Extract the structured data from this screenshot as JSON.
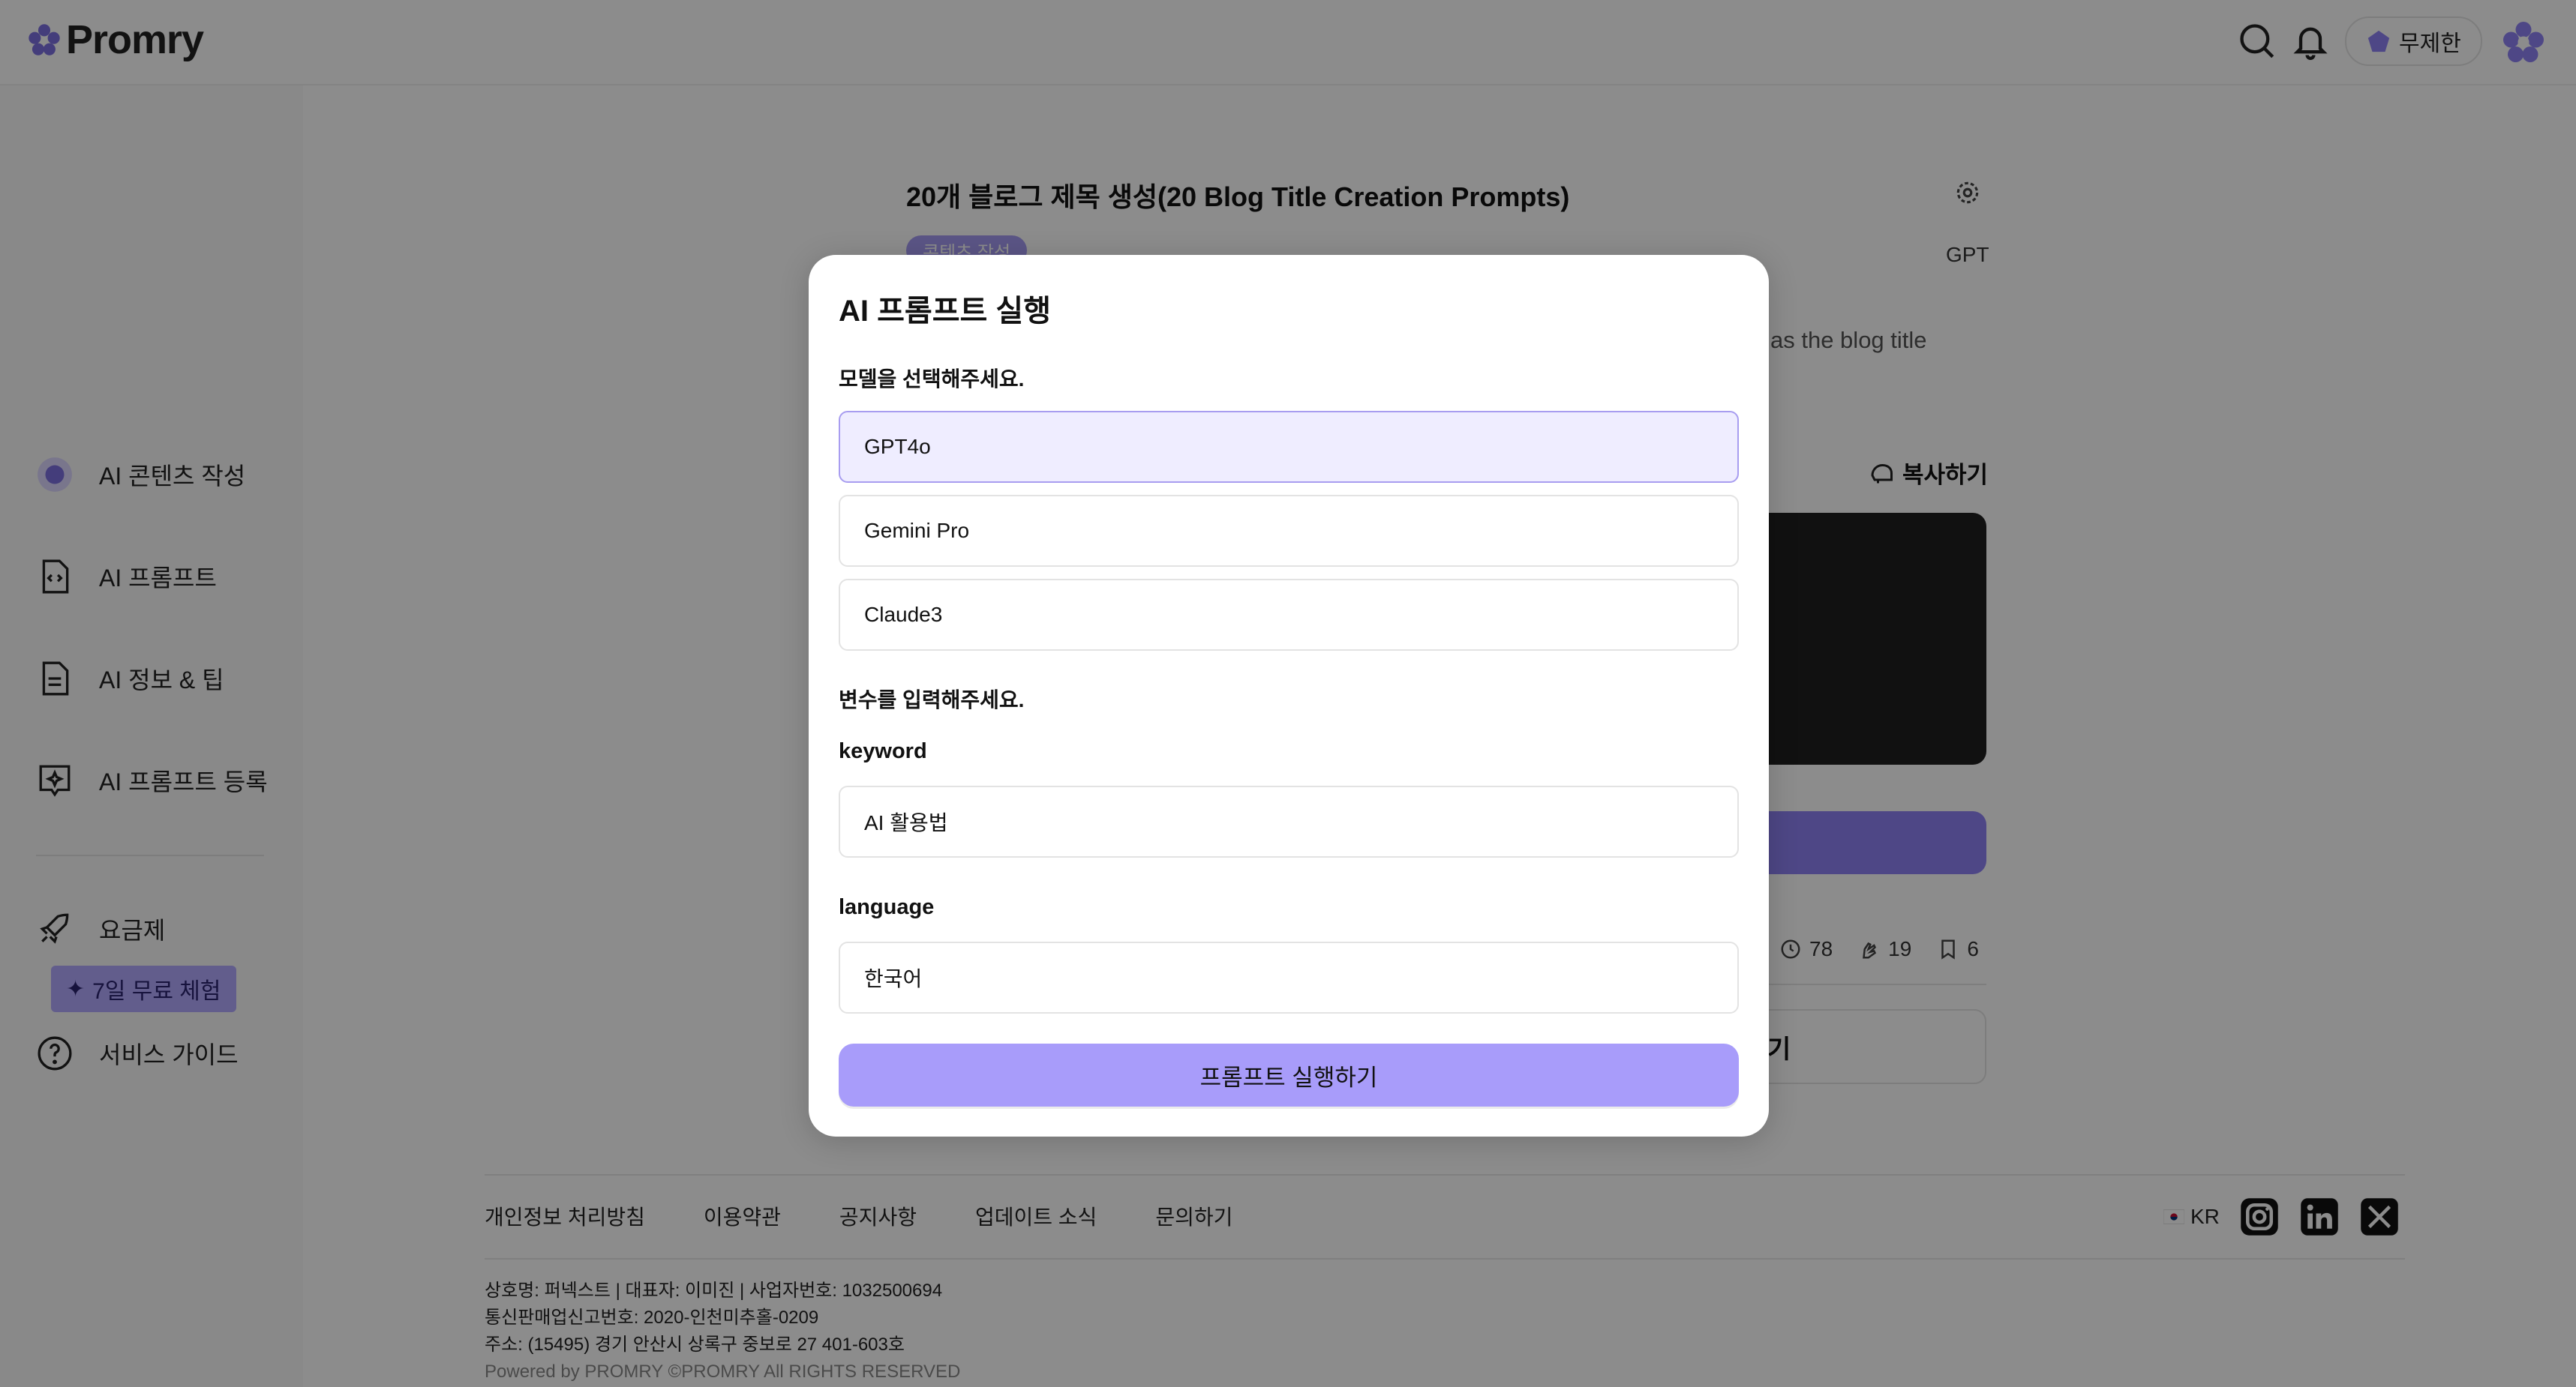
{
  "brand": {
    "name": "Promry",
    "accent": "#8f82f5"
  },
  "header": {
    "plan_label": "무제한",
    "icons": [
      "search-icon",
      "bell-icon",
      "gem-icon",
      "avatar"
    ]
  },
  "sidebar": {
    "items": [
      {
        "label": "AI 콘텐츠 작성",
        "icon": "ai-content-icon"
      },
      {
        "label": "AI 프롬프트",
        "icon": "code-file-icon"
      },
      {
        "label": "AI 정보 & 팁",
        "icon": "document-icon"
      },
      {
        "label": "AI 프롬프트 등록",
        "icon": "register-icon"
      },
      {
        "label": "요금제",
        "icon": "rocket-icon"
      },
      {
        "label": "서비스 가이드",
        "icon": "help-icon"
      }
    ],
    "trial_badge": "7일 무료 체험"
  },
  "main": {
    "title": "20개 블로그 제목 생성(20 Blog Title Creation Prompts)",
    "category": "콘텐츠 작성",
    "model": "GPT",
    "description_tail": "as the blog title",
    "copy_label": "복사하기",
    "stats": {
      "views": "78",
      "likes": "19",
      "bookmarks": "6"
    },
    "secondary_tail": "기"
  },
  "modal": {
    "title": "AI 프롬프트 실행",
    "model_section_label": "모델을 선택해주세요.",
    "models": [
      "GPT4o",
      "Gemini Pro",
      "Claude3"
    ],
    "selected_model": "GPT4o",
    "variables_section_label": "변수를 입력해주세요.",
    "fields": [
      {
        "label": "keyword",
        "value": "AI 활용법"
      },
      {
        "label": "language",
        "value": "한국어"
      }
    ],
    "submit_label": "프롬프트 실행하기"
  },
  "footer": {
    "links": [
      "개인정보 처리방침",
      "이용약관",
      "공지사항",
      "업데이트 소식",
      "문의하기"
    ],
    "language": "KR",
    "social": [
      "instagram-icon",
      "linkedin-icon",
      "x-icon"
    ],
    "business": [
      "상호명: 퍼넥스트 | 대표자: 이미진 | 사업자번호: 1032500694",
      "통신판매업신고번호: 2020-인천미추홀-0209",
      "주소: (15495) 경기 안산시 상록구 중보로 27 401-603호"
    ],
    "copyright": "Powered by PROMRY ©PROMRY All RIGHTS RESERVED"
  }
}
